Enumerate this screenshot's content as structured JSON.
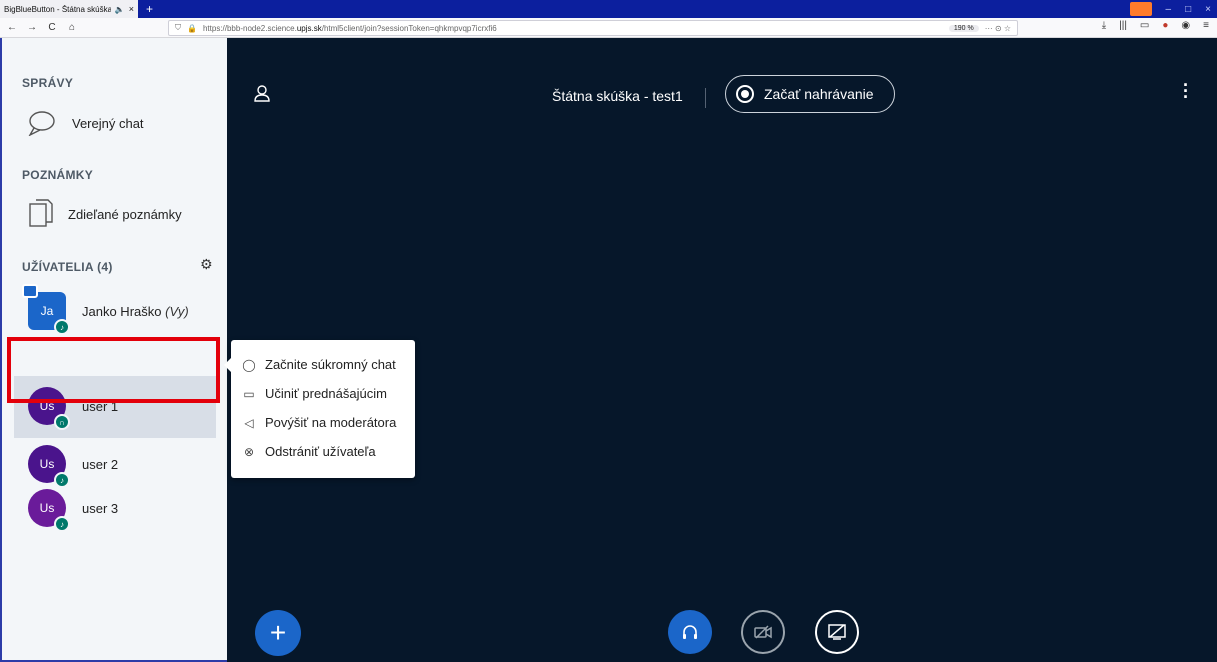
{
  "browser": {
    "tab_title": "BigBlueButton - Štátna skúška -",
    "tab_sound": "🔈",
    "tab_close": "×",
    "new_tab": "+",
    "url_prefix": "https://bbb-node2.science.",
    "url_domain": "upjs.sk",
    "url_rest": "/html5client/join?sessionToken=qhkmpvqp7icrxfi6",
    "zoom": "190 %",
    "page_actions": "··· ⊙ ☆",
    "nav_back": "←",
    "nav_forward": "→",
    "nav_reload": "C",
    "nav_home": "⌂",
    "shield": "⛉",
    "lock": "🔒",
    "tools": [
      "⤓",
      "|||",
      "▭",
      "●",
      "◉",
      "≡"
    ],
    "window_controls": [
      "–",
      "□",
      "×"
    ]
  },
  "sidebar": {
    "messages_title": "SPRÁVY",
    "public_chat": "Verejný chat",
    "notes_title": "POZNÁMKY",
    "shared_notes": "Zdieľané poznámky",
    "users_title": "UŽÍVATELIA (4)",
    "users": [
      {
        "initials": "Ja",
        "name": "Janko Hraško",
        "suffix": "(Vy)",
        "color": "#1b66c9"
      },
      {
        "initials": "Us",
        "name": "user 1",
        "color": "#4a148c"
      },
      {
        "initials": "Us",
        "name": "user 2",
        "color": "#4a148c"
      },
      {
        "initials": "Us",
        "name": "user 3",
        "color": "#6a1b9a"
      }
    ]
  },
  "main": {
    "meeting_title": "Štátna skúška - test1",
    "record_label": "Začať nahrávanie"
  },
  "context_menu": {
    "items": [
      {
        "icon": "chat-bubble-icon",
        "glyph": "◯",
        "label": "Začnite súkromný chat"
      },
      {
        "icon": "presenter-icon",
        "glyph": "▭",
        "label": "Učiniť prednášajúcim"
      },
      {
        "icon": "megaphone-icon",
        "glyph": "◁",
        "label": "Povýšiť na moderátora"
      },
      {
        "icon": "remove-icon",
        "glyph": "⊗",
        "label": "Odstrániť užívateľa"
      }
    ]
  },
  "colors": {
    "main_bg": "#06172a",
    "accent_blue": "#1b66c9",
    "highlight_red": "#e3000b"
  }
}
